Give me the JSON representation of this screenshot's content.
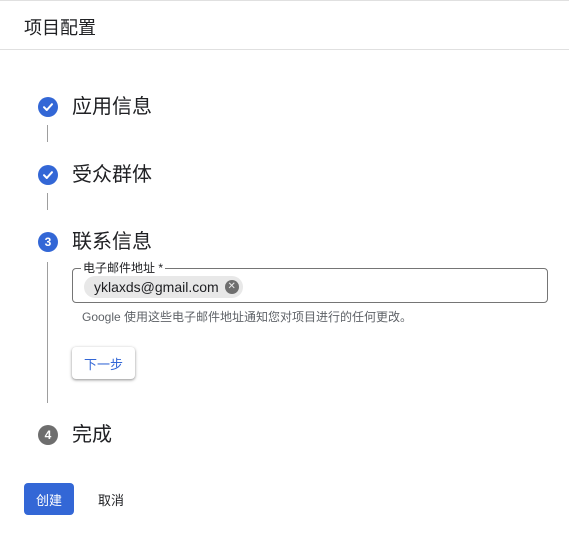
{
  "header": {
    "title": "项目配置"
  },
  "steps": [
    {
      "label": "应用信息",
      "status": "completed",
      "icon": "check-icon"
    },
    {
      "label": "受众群体",
      "status": "completed",
      "icon": "check-icon"
    },
    {
      "label": "联系信息",
      "status": "active",
      "number": "3"
    },
    {
      "label": "完成",
      "status": "pending",
      "number": "4"
    }
  ],
  "contact": {
    "email_label": "电子邮件地址 *",
    "chips": [
      {
        "text": "yklaxds@gmail.com",
        "remove_icon": "close-circle-icon"
      }
    ],
    "hint": "Google 使用这些电子邮件地址通知您对项目进行的任何更改。",
    "next_label": "下一步"
  },
  "footer": {
    "create_label": "创建",
    "cancel_label": "取消"
  },
  "colors": {
    "accent": "#3367d6",
    "pending_step": "#6e6e6e",
    "divider": "#e0e0e0"
  }
}
